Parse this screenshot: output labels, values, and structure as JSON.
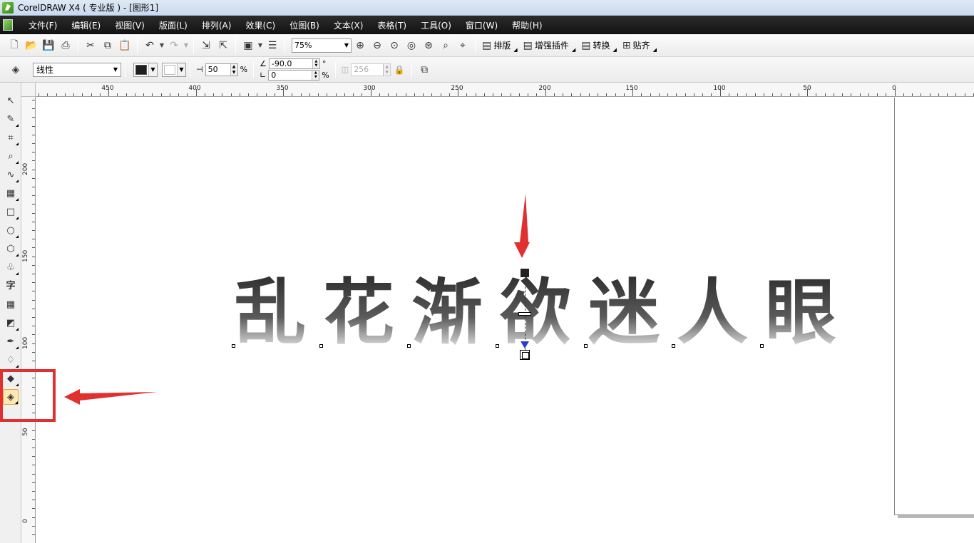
{
  "window": {
    "title": "CorelDRAW X4 ( 专业版 ) - [图形1]"
  },
  "menu": [
    "文件(F)",
    "编辑(E)",
    "视图(V)",
    "版面(L)",
    "排列(A)",
    "效果(C)",
    "位图(B)",
    "文本(X)",
    "表格(T)",
    "工具(O)",
    "窗口(W)",
    "帮助(H)"
  ],
  "toolbar": {
    "zoom": "75%",
    "buttons": [
      "排版",
      "增强插件",
      "转换",
      "贴齐"
    ]
  },
  "property_bar": {
    "fill_type": "线性",
    "midpoint": "50",
    "midpoint_unit": "%",
    "angle": "-90.0",
    "angle_unit": "°",
    "edge_pad": "0",
    "edge_pad_unit": "%",
    "steps": "256"
  },
  "rulers": {
    "horizontal": [
      "450",
      "400",
      "350",
      "300",
      "250",
      "200",
      "150",
      "100",
      "50",
      "0"
    ],
    "vertical": [
      "200",
      "150",
      "100",
      "50",
      "0"
    ]
  },
  "canvas": {
    "text": "乱花渐欲迷人眼"
  },
  "colors": {
    "menubar": "#1a1a1a",
    "annotation": "#e03030",
    "gradient_top": "#2a2a2a",
    "gradient_bottom": "#ffffff",
    "gradient_end_arrow": "#2a3bd1"
  }
}
